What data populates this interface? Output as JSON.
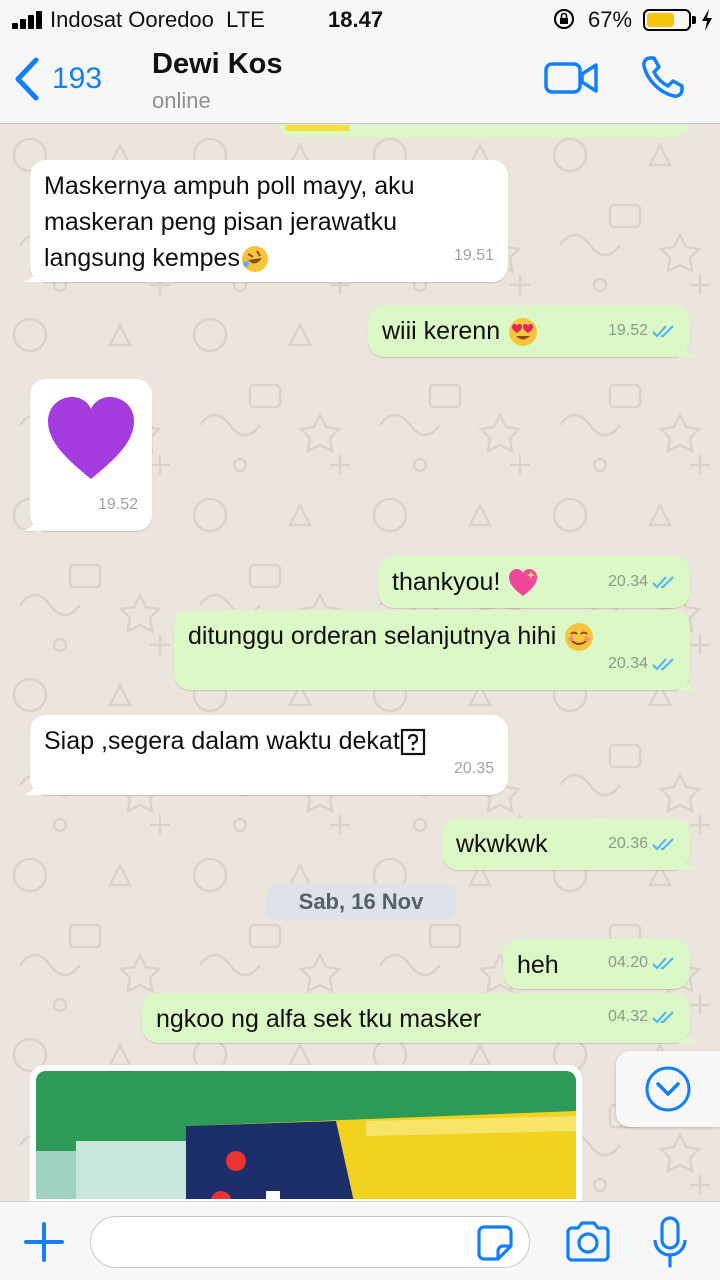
{
  "status_bar": {
    "carrier": "Indosat Ooredoo",
    "network": "LTE",
    "time": "18.47",
    "battery_percent": "67%",
    "battery_level": 0.67,
    "battery_color": "#f3c40e"
  },
  "nav": {
    "back_count": "193",
    "contact_name": "Dewi Kos",
    "contact_status": "online",
    "accent_color": "#147efb"
  },
  "messages": [
    {
      "direction": "in",
      "text": "Maskernya ampuh poll mayy, aku maskeran peng pisan jerawatku langsung kempes",
      "emoji": "rolling-on-floor-laughing",
      "time": "19.51"
    },
    {
      "direction": "out",
      "text": "wiii kerenn",
      "emoji": "heart-eyes",
      "time": "19.52",
      "read": true
    },
    {
      "direction": "in",
      "text": "",
      "emoji": "purple-heart",
      "time": "19.52"
    },
    {
      "direction": "out",
      "text": "thankyou!",
      "emoji": "sparkling-heart",
      "time": "20.34",
      "read": true
    },
    {
      "direction": "out",
      "text": "ditunggu orderan selanjutnya hihi",
      "emoji": "smiling-face",
      "time": "20.34",
      "read": true
    },
    {
      "direction": "in",
      "text": "Siap ,segera dalam waktu dekat",
      "emoji": "unknown-glyph",
      "time": "20.35"
    },
    {
      "direction": "out",
      "text": "wkwkwk",
      "time": "20.36",
      "read": true
    },
    {
      "direction": "out",
      "text": "heh",
      "time": "04.20",
      "read": true
    },
    {
      "direction": "out",
      "text": "ngkoo ng alfa sek tku masker",
      "time": "04.32",
      "read": true
    }
  ],
  "date_separator": "Sab, 16 Nov",
  "colors": {
    "incoming_bubble": "#ffffff",
    "outgoing_bubble": "#dcf8c6",
    "read_tick": "#4fb3f6",
    "chat_background": "#ece5dd"
  },
  "input": {
    "placeholder": "",
    "value": ""
  },
  "icons": [
    "back-chevron-icon",
    "video-call-icon",
    "phone-icon",
    "plus-icon",
    "sticker-icon",
    "camera-icon",
    "microphone-icon",
    "scroll-down-icon"
  ]
}
